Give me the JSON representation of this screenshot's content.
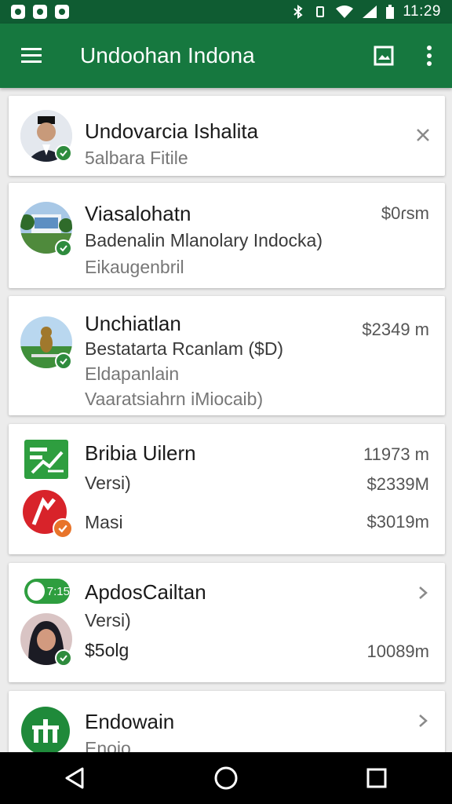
{
  "status_bar": {
    "time": "11:29",
    "icons": [
      "notification-icon",
      "bluetooth-icon",
      "wifi-icon",
      "signal-icon",
      "battery-icon"
    ]
  },
  "app_bar": {
    "title": "Undoohan Indona",
    "icons": [
      "menu-icon",
      "gallery-icon",
      "more-vert-icon"
    ]
  },
  "colors": {
    "status_bar": "#0f5c32",
    "app_bar": "#16783f",
    "verified_badge": "#2e8b3d",
    "orange_badge": "#e8742a"
  },
  "cards": [
    {
      "title": "Undovarcia Ishalita",
      "subtitle": "5albara Fitile",
      "action_icon": "close-icon"
    },
    {
      "title": "Viasalohatn",
      "line1": "Badenalin Mlanolary Indocka)",
      "line2": "Eikaugenbril",
      "amount": "$0ɾsm"
    },
    {
      "title": "Unchiatlan",
      "line1": "Bestatarta Rcanlam ($D)",
      "line2": "Eldapanlain",
      "line3": "Vaaratsiahrn iMiocaib)",
      "amount": "$2349 m"
    },
    {
      "title": "Bribia Uilern",
      "line1": "Versi)",
      "line2": "Masi",
      "amount1": "11973 m",
      "amount2": "$2339M",
      "amount3": "$3019m"
    },
    {
      "badge_text": "7:15",
      "title": "ApdosCailtan",
      "line1": "Versi)",
      "line2": "$5olg",
      "amount": "10089m",
      "action_icon": "chevron-right-icon"
    },
    {
      "title": "Endowain",
      "line1": "Enoio",
      "action_icon": "chevron-right-icon"
    }
  ],
  "nav_bar": {
    "icons": [
      "back-icon",
      "home-icon",
      "recents-icon"
    ]
  }
}
